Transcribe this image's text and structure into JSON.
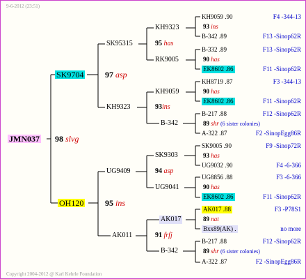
{
  "header": {
    "stamp": "9-6-2012 (23:51)"
  },
  "footer": {
    "copyright": "Copyright 2004-2012 @ Karl Kehrle Foundation"
  },
  "pedigree": {
    "root": {
      "name": "JMN037"
    },
    "g1_upper": {
      "year": "98",
      "breed": "slvg"
    },
    "g1_lower": {
      "year": "95",
      "breed": "ins"
    },
    "sire": {
      "name": "SK9704"
    },
    "dam": {
      "name": "OH120"
    },
    "sk9704": {
      "sire": {
        "name": "SK95315",
        "year": "97",
        "breed": "asp"
      },
      "dam": {
        "name": "KH9323",
        "year": "93",
        "breed": "ins"
      },
      "sk95315": {
        "sire": {
          "name": "KH9323",
          "year": "95",
          "breed": "has"
        },
        "dam": {
          "name": "RK9005"
        }
      },
      "kh9323": {
        "sire": {
          "name": "KH9059",
          "year": "93",
          "breed": "ins"
        },
        "dam": {
          "name": "B-342"
        }
      }
    },
    "oh120": {
      "sire": {
        "name": "UG9409",
        "year": "95",
        "breed": "ins"
      },
      "dam": {
        "name": "AK011",
        "year": "91",
        "breed": "frfj"
      },
      "ug9409": {
        "sire": {
          "name": "SK9303",
          "year": "94",
          "breed": "asp"
        },
        "dam": {
          "name": "UG9041"
        }
      },
      "ak011": {
        "sire": {
          "name": "AK017",
          "year": "89",
          "breed": "nat"
        },
        "dam": {
          "name": "B-342"
        }
      }
    },
    "g4": [
      {
        "line": "KH9059 .90",
        "pn": "F4 -344-13"
      },
      {
        "year": "93",
        "breed": "ins"
      },
      {
        "line": "B-342 .89",
        "pn": "F13 -Sinop62R"
      },
      {
        "line": "B-332 .89",
        "pn": "F13 -Sinop62R"
      },
      {
        "year": "90",
        "breed": "has"
      },
      {
        "line": "EK8602 .86",
        "pn": "F11 -Sinop62R"
      },
      {
        "line": "KH8719 .87",
        "pn": "F3 -344-13"
      },
      {
        "year": "90",
        "breed": "has"
      },
      {
        "line": "EK8602 .86",
        "pn": "F11 -Sinop62R"
      },
      {
        "line": "B-217 .88",
        "pn": "F12 -Sinop62R"
      },
      {
        "year": "89",
        "breed": "shr",
        "note": "(6 sister colonies)"
      },
      {
        "line": "A-322 .87",
        "pn": "F2 -SinopEgg86R"
      },
      {
        "line": "SK9005 .90",
        "pn": "F9 -Sinop72R"
      },
      {
        "year": "93",
        "breed": "has"
      },
      {
        "line": "UG9032 .90",
        "pn": "F4 -6-366"
      },
      {
        "line": "UG8856 .88",
        "pn": "F3 -6-366"
      },
      {
        "year": "90",
        "breed": "has"
      },
      {
        "line": "EK8602 .86",
        "pn": "F11 -Sinop62R"
      },
      {
        "line": "AK017 .88",
        "pn": "F3 -P78S1"
      },
      {
        "year": "89",
        "breed": "nat"
      },
      {
        "line": "Bxx89(AK) .",
        "pn": "no more"
      },
      {
        "line": "B-217 .88",
        "pn": "F12 -Sinop62R"
      },
      {
        "year": "89",
        "breed": "shr",
        "note": "(6 sister colonies)"
      },
      {
        "line": "A-322 .87",
        "pn": "F2 -SinopEgg86R"
      }
    ]
  },
  "colors": {
    "frame": "#cc44cc",
    "breed": "#d00000",
    "pedigree_no": "#0000cc",
    "root_bg": "#ffc0ff",
    "sire_bg": "#00e0e0",
    "dam_bg": "#ffff00"
  }
}
